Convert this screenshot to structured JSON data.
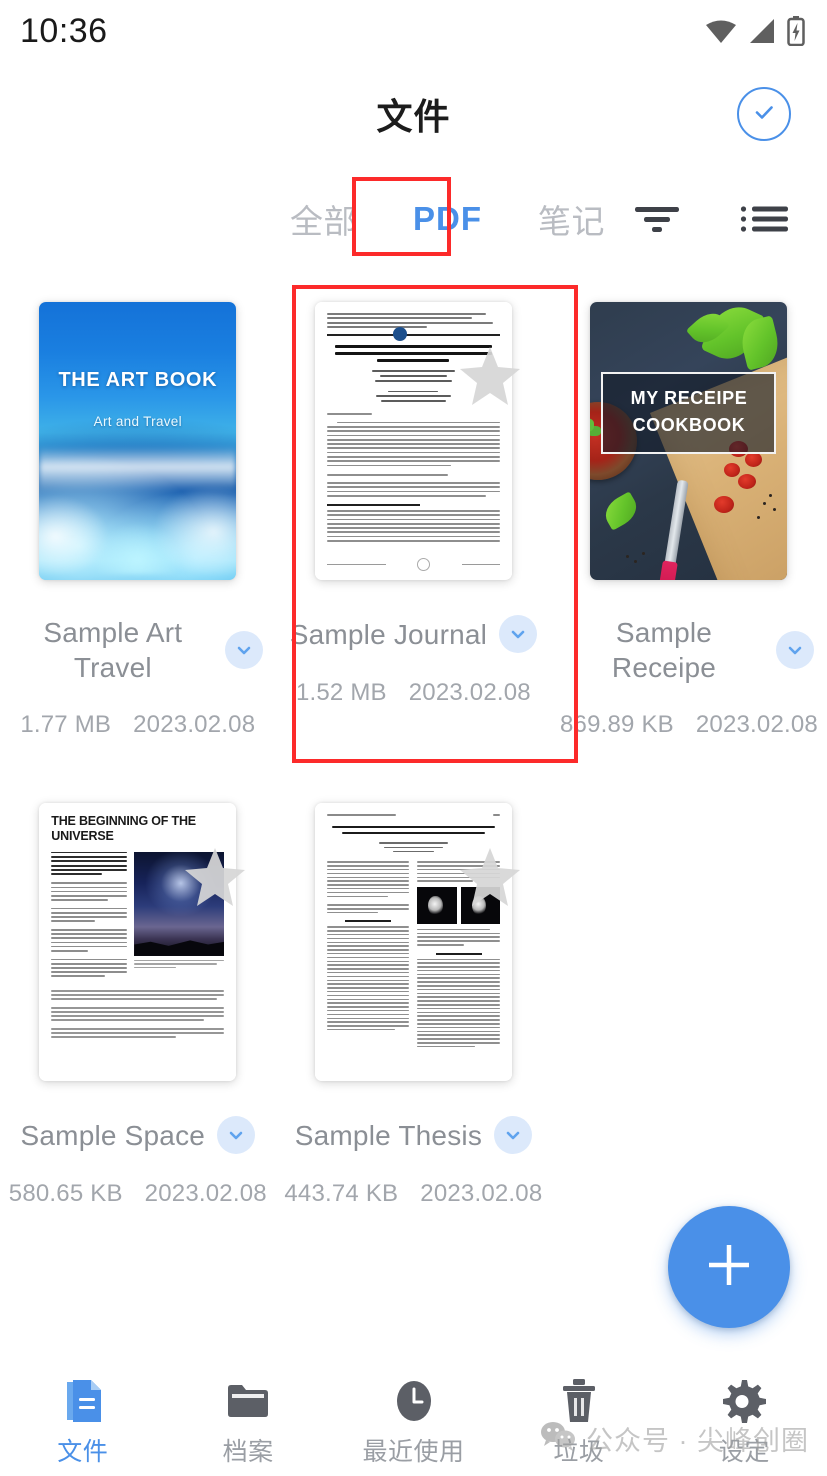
{
  "status_bar": {
    "time": "10:36",
    "icons": [
      "wifi-icon",
      "cellular-signal-icon",
      "battery-charging-icon"
    ]
  },
  "header": {
    "title": "文件",
    "select_all_icon": "check-circle-icon"
  },
  "tabs": {
    "items": [
      {
        "label": "全部",
        "active": false
      },
      {
        "label": "PDF",
        "active": true
      },
      {
        "label": "笔记",
        "active": false
      }
    ],
    "sort_icon": "sort-icon",
    "list_view_icon": "list-view-icon"
  },
  "annotations": {
    "pdf_tab_highlight": "red-box-pdf-tab",
    "journal_card_highlight": "red-box-sample-journal",
    "highlight_color": "#fc2a2a"
  },
  "files": [
    {
      "name": "Sample Art Travel",
      "size": "1.77 MB",
      "date": "2023.02.08",
      "thumb": "art-book-cover",
      "cover_title": "THE ART BOOK",
      "cover_subtitle": "Art and Travel",
      "starred": false
    },
    {
      "name": "Sample Journal",
      "size": "1.52 MB",
      "date": "2023.02.08",
      "thumb": "journal-page",
      "starred": true,
      "highlighted": true
    },
    {
      "name": "Sample Receipe",
      "size": "869.89 KB",
      "date": "2023.02.08",
      "thumb": "cookbook-cover",
      "cover_title": "MY RECEIPE",
      "cover_subtitle": "COOKBOOK",
      "starred": false
    },
    {
      "name": "Sample Space",
      "size": "580.65 KB",
      "date": "2023.02.08",
      "thumb": "universe-article-page",
      "cover_title": "THE BEGINNING OF THE UNIVERSE",
      "starred": true
    },
    {
      "name": "Sample Thesis",
      "size": "443.74 KB",
      "date": "2023.02.08",
      "thumb": "thesis-page",
      "starred": true
    }
  ],
  "fab": {
    "icon": "plus-icon",
    "color": "#4a90e8"
  },
  "bottom_nav": {
    "items": [
      {
        "label": "文件",
        "icon": "document-icon",
        "active": true
      },
      {
        "label": "档案",
        "icon": "folder-icon",
        "active": false
      },
      {
        "label": "最近使用",
        "icon": "clock-icon",
        "active": false
      },
      {
        "label": "垃圾",
        "icon": "trash-icon",
        "active": false
      },
      {
        "label": "设定",
        "icon": "gear-icon",
        "active": false
      }
    ],
    "active_color": "#4a90e8",
    "inactive_color": "#9a9ea4"
  },
  "watermark": {
    "icon": "wechat-icon",
    "text": "公众号 · 尖峰创圈"
  }
}
